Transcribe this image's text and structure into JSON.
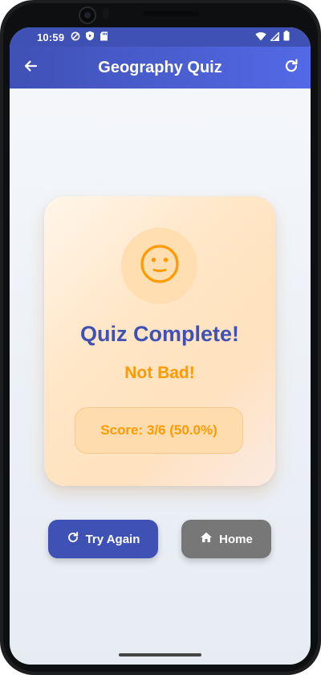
{
  "status_bar": {
    "time": "10:59",
    "left_icons": [
      "vpn-shield-icon",
      "play-protect-icon",
      "sd-card-icon"
    ],
    "right_icons": [
      "wifi-icon",
      "signal-icon",
      "battery-icon"
    ]
  },
  "app_bar": {
    "title": "Geography Quiz",
    "back_icon": "arrow-left-icon",
    "refresh_icon": "refresh-icon"
  },
  "result_card": {
    "emoji": "neutral-face-icon",
    "title": "Quiz Complete!",
    "subtitle": "Not Bad!",
    "score_text": "Score: 3/6 (50.0%)"
  },
  "buttons": {
    "try_again": "Try Again",
    "home": "Home"
  },
  "colors": {
    "primary": "#3f51b5",
    "accent_orange": "#ff9a00",
    "home_button": "#777777"
  }
}
